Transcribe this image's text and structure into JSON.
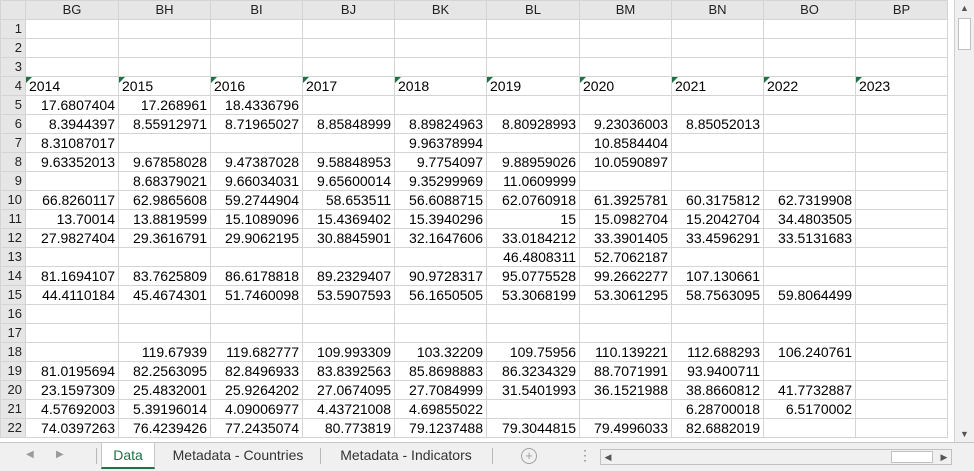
{
  "columns": [
    "BG",
    "BH",
    "BI",
    "BJ",
    "BK",
    "BL",
    "BM",
    "BN",
    "BO",
    "BP"
  ],
  "rows": [
    {
      "n": "1",
      "cells": [
        "",
        "",
        "",
        "",
        "",
        "",
        "",
        "",
        "",
        ""
      ]
    },
    {
      "n": "2",
      "cells": [
        "",
        "",
        "",
        "",
        "",
        "",
        "",
        "",
        "",
        ""
      ]
    },
    {
      "n": "3",
      "cells": [
        "",
        "",
        "",
        "",
        "",
        "",
        "",
        "",
        "",
        ""
      ]
    },
    {
      "n": "4",
      "cells": [
        "2014",
        "2015",
        "2016",
        "2017",
        "2018",
        "2019",
        "2020",
        "2021",
        "2022",
        "2023"
      ]
    },
    {
      "n": "5",
      "cells": [
        "17.6807404",
        "17.268961",
        "18.4336796",
        "",
        "",
        "",
        "",
        "",
        "",
        ""
      ]
    },
    {
      "n": "6",
      "cells": [
        "8.3944397",
        "8.55912971",
        "8.71965027",
        "8.85848999",
        "8.89824963",
        "8.80928993",
        "9.23036003",
        "8.85052013",
        "",
        ""
      ]
    },
    {
      "n": "7",
      "cells": [
        "8.31087017",
        "",
        "",
        "",
        "9.96378994",
        "",
        "10.8584404",
        "",
        "",
        ""
      ]
    },
    {
      "n": "8",
      "cells": [
        "9.63352013",
        "9.67858028",
        "9.47387028",
        "9.58848953",
        "9.7754097",
        "9.88959026",
        "10.0590897",
        "",
        "",
        ""
      ]
    },
    {
      "n": "9",
      "cells": [
        "",
        "8.68379021",
        "9.66034031",
        "9.65600014",
        "9.35299969",
        "11.0609999",
        "",
        "",
        "",
        ""
      ]
    },
    {
      "n": "10",
      "cells": [
        "66.8260117",
        "62.9865608",
        "59.2744904",
        "58.653511",
        "56.6088715",
        "62.0760918",
        "61.3925781",
        "60.3175812",
        "62.7319908",
        ""
      ]
    },
    {
      "n": "11",
      "cells": [
        "13.70014",
        "13.8819599",
        "15.1089096",
        "15.4369402",
        "15.3940296",
        "15",
        "15.0982704",
        "15.2042704",
        "34.4803505",
        ""
      ]
    },
    {
      "n": "12",
      "cells": [
        "27.9827404",
        "29.3616791",
        "29.9062195",
        "30.8845901",
        "32.1647606",
        "33.0184212",
        "33.3901405",
        "33.4596291",
        "33.5131683",
        ""
      ]
    },
    {
      "n": "13",
      "cells": [
        "",
        "",
        "",
        "",
        "",
        "46.4808311",
        "52.7062187",
        "",
        "",
        ""
      ]
    },
    {
      "n": "14",
      "cells": [
        "81.1694107",
        "83.7625809",
        "86.6178818",
        "89.2329407",
        "90.9728317",
        "95.0775528",
        "99.2662277",
        "107.130661",
        "",
        ""
      ]
    },
    {
      "n": "15",
      "cells": [
        "44.4110184",
        "45.4674301",
        "51.7460098",
        "53.5907593",
        "56.1650505",
        "53.3068199",
        "53.3061295",
        "58.7563095",
        "59.8064499",
        ""
      ]
    },
    {
      "n": "16",
      "cells": [
        "",
        "",
        "",
        "",
        "",
        "",
        "",
        "",
        "",
        ""
      ]
    },
    {
      "n": "17",
      "cells": [
        "",
        "",
        "",
        "",
        "",
        "",
        "",
        "",
        "",
        ""
      ]
    },
    {
      "n": "18",
      "cells": [
        "",
        "119.67939",
        "119.682777",
        "109.993309",
        "103.32209",
        "109.75956",
        "110.139221",
        "112.688293",
        "106.240761",
        ""
      ]
    },
    {
      "n": "19",
      "cells": [
        "81.0195694",
        "82.2563095",
        "82.8496933",
        "83.8392563",
        "85.8698883",
        "86.3234329",
        "88.7071991",
        "93.9400711",
        "",
        ""
      ]
    },
    {
      "n": "20",
      "cells": [
        "23.1597309",
        "25.4832001",
        "25.9264202",
        "27.0674095",
        "27.7084999",
        "31.5401993",
        "36.1521988",
        "38.8660812",
        "41.7732887",
        ""
      ]
    },
    {
      "n": "21",
      "cells": [
        "4.57692003",
        "5.39196014",
        "4.09006977",
        "4.43721008",
        "4.69855022",
        "",
        "",
        "6.28700018",
        "6.5170002",
        ""
      ]
    },
    {
      "n": "22",
      "cells": [
        "74.0397263",
        "76.4239426",
        "77.2435074",
        "80.773819",
        "79.1237488",
        "79.3044815",
        "79.4996033",
        "82.6882019",
        "",
        ""
      ]
    }
  ],
  "sheet_tabs": [
    {
      "label": "Data",
      "active": true
    },
    {
      "label": "Metadata - Countries",
      "active": false
    },
    {
      "label": "Metadata - Indicators",
      "active": false
    }
  ],
  "icons": {
    "add_sheet": "plus-circle-icon",
    "nav_prev": "triangle-left-icon",
    "nav_next": "triangle-right-icon",
    "options": "vertical-dots-icon",
    "scroll_up": "triangle-up-icon",
    "scroll_down": "triangle-down-icon",
    "scroll_left": "triangle-left-icon",
    "scroll_right": "triangle-right-icon"
  },
  "colors": {
    "accent": "#1e7145",
    "header_bg": "#e6e6e6",
    "grid_line": "#d4d4d4"
  }
}
